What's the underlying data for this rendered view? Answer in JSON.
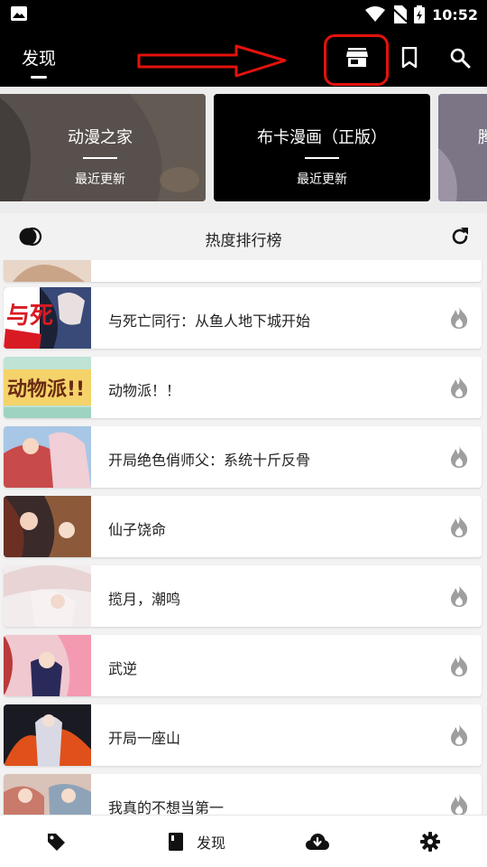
{
  "status_bar": {
    "time": "10:52"
  },
  "app_bar": {
    "title": "发现",
    "icons": [
      "store-icon",
      "bookmark-icon",
      "search-icon"
    ]
  },
  "sources": [
    {
      "name": "动漫之家",
      "subtitle": "最近更新"
    },
    {
      "name": "布卡漫画（正版）",
      "subtitle": "最近更新"
    },
    {
      "name": "腾"
    }
  ],
  "ranking": {
    "title": "热度排行榜"
  },
  "list": [
    {
      "title": "与死亡同行：从鱼人地下城开始"
    },
    {
      "title": "动物派！！"
    },
    {
      "title": "开局绝色俏师父：系统十斤反骨"
    },
    {
      "title": "仙子饶命"
    },
    {
      "title": "揽月，潮鸣"
    },
    {
      "title": "武逆"
    },
    {
      "title": "开局一座山"
    },
    {
      "title": "我真的不想当第一"
    }
  ],
  "cover_logo_texts": [
    "与死",
    "动物派!!"
  ],
  "bottom_nav": {
    "discover_label": "发现"
  },
  "colors": {
    "bar": "#000000",
    "highlight": "#e3120b",
    "background": "#f2f2f2"
  }
}
